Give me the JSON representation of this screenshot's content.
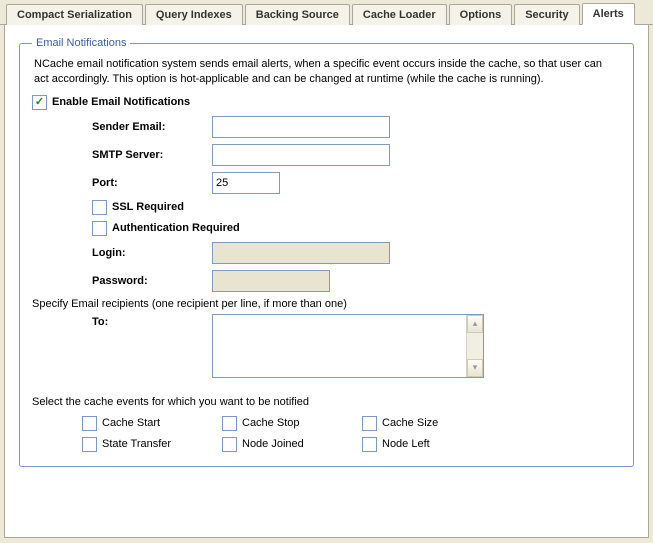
{
  "tabs": [
    {
      "label": "Compact Serialization"
    },
    {
      "label": "Query Indexes"
    },
    {
      "label": "Backing Source"
    },
    {
      "label": "Cache Loader"
    },
    {
      "label": "Options"
    },
    {
      "label": "Security"
    },
    {
      "label": "Alerts"
    }
  ],
  "group_title": "Email Notifications",
  "description": "NCache email notification system sends email alerts, when a specific event occurs inside the cache, so that user can act accordingly. This option is hot-applicable and can be changed at runtime (while the cache is running).",
  "enable_label": "Enable Email Notifications",
  "fields": {
    "sender_label": "Sender Email:",
    "sender_value": "",
    "smtp_label": "SMTP Server:",
    "smtp_value": "",
    "port_label": "Port:",
    "port_value": "25",
    "ssl_label": "SSL Required",
    "auth_label": "Authentication Required",
    "login_label": "Login:",
    "login_value": "",
    "password_label": "Password:",
    "password_value": ""
  },
  "recipients_label": "Specify Email recipients (one recipient per line, if more than one)",
  "to_label": "To:",
  "to_value": "",
  "events_label": "Select the cache events for which you want to be notified",
  "events": [
    {
      "label": "Cache Start"
    },
    {
      "label": "Cache Stop"
    },
    {
      "label": "Cache Size"
    },
    {
      "label": "State Transfer"
    },
    {
      "label": "Node Joined"
    },
    {
      "label": "Node Left"
    }
  ]
}
